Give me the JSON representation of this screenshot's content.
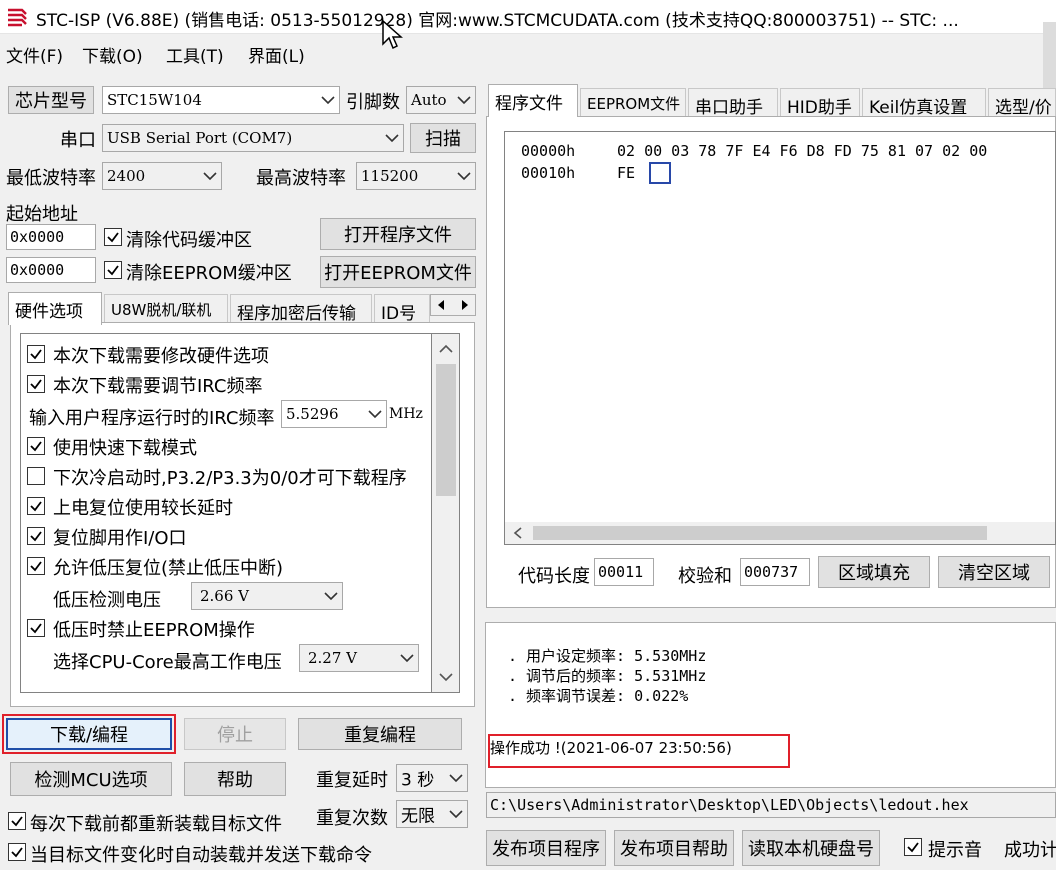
{
  "window": {
    "title": "STC-ISP (V6.88E) (销售电话: 0513-55012928) 官网:www.STCMCUDATA.com  (技术支持QQ:800003751) -- STC: ..."
  },
  "menu": [
    "文件(F)",
    "下载(O)",
    "工具(T)",
    "界面(L)"
  ],
  "chip": {
    "label": "芯片型号",
    "value": "STC15W104",
    "pins_label": "引脚数",
    "pins_value": "Auto"
  },
  "port": {
    "label": "串口",
    "value": "USB Serial Port (COM7)",
    "scan": "扫描"
  },
  "baud": {
    "min_label": "最低波特率",
    "min_value": "2400",
    "max_label": "最高波特率",
    "max_value": "115200"
  },
  "address": {
    "label": "起始地址",
    "code_addr": "0x0000",
    "clear_code": "清除代码缓冲区",
    "open_prog": "打开程序文件",
    "eeprom_addr": "0x0000",
    "clear_eeprom": "清除EEPROM缓冲区",
    "open_eeprom": "打开EEPROM文件"
  },
  "left_tabs": [
    "硬件选项",
    "U8W脱机/联机",
    "程序加密后传输",
    "ID号"
  ],
  "hw_options": {
    "opt1": "本次下载需要修改硬件选项",
    "opt2": "本次下载需要调节IRC频率",
    "irc_label": "输入用户程序运行时的IRC频率",
    "irc_value": "5.5296",
    "irc_unit": "MHz",
    "opt3": "使用快速下载模式",
    "opt4": "下次冷启动时,P3.2/P3.3为0/0才可下载程序",
    "opt5": "上电复位使用较长延时",
    "opt6": "复位脚用作I/O口",
    "opt7": "允许低压复位(禁止低压中断)",
    "lv_label": "低压检测电压",
    "lv_value": "2.66 V",
    "opt8": "低压时禁止EEPROM操作",
    "cpu_label": "选择CPU-Core最高工作电压",
    "cpu_value": "2.27 V"
  },
  "actions": {
    "download": "下载/编程",
    "stop": "停止",
    "reprogram": "重复编程",
    "detect": "检测MCU选项",
    "help": "帮助",
    "delay_label": "重复延时",
    "delay_value": "3 秒",
    "count_label": "重复次数",
    "count_value": "无限",
    "reload": "每次下载前都重新装载目标文件",
    "autoload": "当目标文件变化时自动装载并发送下载命令"
  },
  "right_tabs": [
    "程序文件",
    "EEPROM文件",
    "串口助手",
    "HID助手",
    "Keil仿真设置",
    "选型/价"
  ],
  "hex": {
    "line1_addr": "00000h",
    "line1_bytes": "02 00 03 78 7F E4 F6 D8 FD 75 81 07 02 00",
    "line2_addr": "00010h",
    "line2_bytes": "FE"
  },
  "code_info": {
    "len_label": "代码长度",
    "len_value": "00011",
    "sum_label": "校验和",
    "sum_value": "000737",
    "fill": "区域填充",
    "clear": "清空区域"
  },
  "log": {
    "line1": ". 用户设定频率: 5.530MHz",
    "line2": ". 调节后的频率: 5.531MHz",
    "line3": ". 频率调节误差: 0.022%",
    "success": "操作成功 !(2021-06-07 23:50:56)"
  },
  "bottom": {
    "path": "C:\\Users\\Administrator\\Desktop\\LED\\Objects\\ledout.hex",
    "publish_prog": "发布项目程序",
    "publish_help": "发布项目帮助",
    "read_disk": "读取本机硬盘号",
    "beep": "提示音",
    "success_count": "成功计"
  },
  "colors": {
    "highlight_red": "#e0202a",
    "focus_blue": "#1f4fa8",
    "select_blue": "#2848a8"
  }
}
